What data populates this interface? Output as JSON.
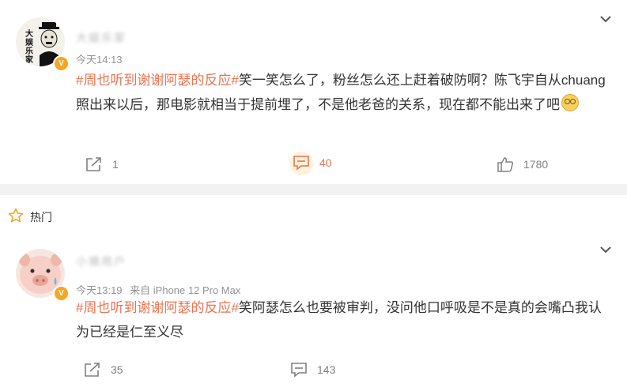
{
  "post1": {
    "username": "大娱乐家",
    "avatar_text": "大娱乐家",
    "verified_badge": "V",
    "time": "今天14:13",
    "topic": "#周也听到谢谢阿瑟的反应#",
    "text": "笑一笑怎么了，粉丝怎么还上赶着破防啊？陈飞宇自从chuang照出来以后，那电影就相当于提前埋了，不是他老爸的关系，现在都不能出来了吧",
    "emoji": "dizzy-face-emoji",
    "share_count": "1",
    "comment_count": "40",
    "like_count": "1780"
  },
  "hot_section": {
    "label": "热门",
    "icon": "star-icon"
  },
  "post2": {
    "username": "小猪用户",
    "verified_badge": "V",
    "time": "今天13:19",
    "source": "来自 iPhone 12 Pro Max",
    "topic": "#周也听到谢谢阿瑟的反应#",
    "text": "笑阿瑟怎么也要被审判，没问他口呼吸是不是真的会嘴凸我认为已经是仁至义尽",
    "share_count": "35",
    "comment_count": "143"
  },
  "colors": {
    "topic": "#eb7350",
    "badge": "#f5a623",
    "meta": "#939393",
    "divider": "#f2f2f2"
  }
}
